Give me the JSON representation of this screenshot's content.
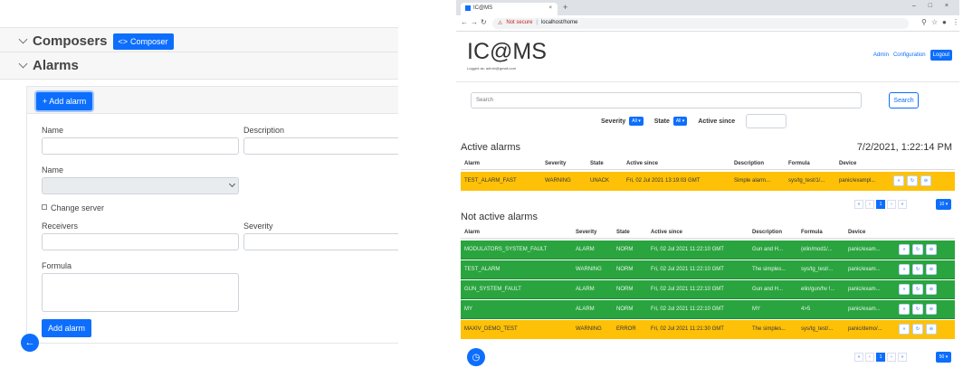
{
  "left": {
    "composers_title": "Composers",
    "composer_button": "Composer",
    "composer_icon": "code-icon",
    "alarms_title": "Alarms",
    "add_alarm_top": "+ Add alarm",
    "name_label": "Name",
    "description_label": "Description",
    "name2_label": "Name",
    "change_server_label": "Change server",
    "receivers_label": "Receivers",
    "severity_label": "Severity",
    "formula_label": "Formula",
    "add_alarm_button": "Add alarm",
    "back_icon": "←"
  },
  "browser": {
    "tab_title": "IC@MS",
    "tab_close": "×",
    "new_tab": "+",
    "window_controls": "– □ ×",
    "not_secure": "Not secure",
    "url": "localhost/home"
  },
  "app": {
    "brand": "IC@MS",
    "logged_as": "Logged as: admin@gmail.com",
    "nav": {
      "admin": "Admin",
      "configuration": "Configuration",
      "logout": "Logout"
    },
    "search_placeholder": "Search",
    "search_button": "Search",
    "filters": {
      "severity": "Severity",
      "state": "State",
      "all": "All ▾",
      "active_since": "Active since"
    },
    "active_title": "Active alarms",
    "datetime": "7/2/2021, 1:22:14 PM",
    "not_active_title": "Not active alarms",
    "columns": {
      "alarm": "Alarm",
      "severity": "Severity",
      "state": "State",
      "active_since": "Active since",
      "description": "Description",
      "formula": "Formula",
      "device": "Device"
    },
    "active_rows": [
      {
        "alarm": "TEST_ALARM_FAST",
        "severity": "WARNING",
        "state": "UNACK",
        "since": "Fri, 02 Jul 2021 13:19:03 GMT",
        "description": "Simple alarm...",
        "formula": "sys/tg_test/1/...",
        "device": "panic/exampl..."
      }
    ],
    "not_active_rows": [
      {
        "alarm": "MODULATORS_SYSTEM_FAULT",
        "severity": "ALARM",
        "state": "NORM",
        "since": "Fri, 02 Jul 2021 11:22:10 GMT",
        "description": "Gun and H...",
        "formula": "(elin/mod1/...",
        "device": "panic/exam..."
      },
      {
        "alarm": "TEST_ALARM",
        "severity": "WARNING",
        "state": "NORM",
        "since": "Fri, 02 Jul 2021 11:22:10 GMT",
        "description": "The simples...",
        "formula": "sys/tg_test/...",
        "device": "panic/exam..."
      },
      {
        "alarm": "GUN_SYSTEM_FAULT",
        "severity": "ALARM",
        "state": "NORM",
        "since": "Fri, 02 Jul 2021 11:22:10 GMT",
        "description": "Gun and H...",
        "formula": "elin/gun/hv !...",
        "device": "panic/exam..."
      },
      {
        "alarm": "MY",
        "severity": "ALARM",
        "state": "NORM",
        "since": "Fri, 02 Jul 2021 11:22:10 GMT",
        "description": "MY",
        "formula": "4>5",
        "device": "panic/exam..."
      },
      {
        "alarm": "MAXIV_DEMO_TEST",
        "severity": "WARNING",
        "state": "ERROR",
        "since": "Fri, 02 Jul 2021 11:21:30 GMT",
        "description": "The simples...",
        "formula": "sys/tg_test/...",
        "device": "panic/demo/..."
      }
    ],
    "pager": {
      "first": "«",
      "prev": "‹",
      "page": "1",
      "next": "›",
      "last": "»"
    },
    "per_page_active": "10 ▾",
    "per_page_not_active": "50 ▾",
    "row_actions": [
      "«",
      "↻",
      "⊖"
    ]
  },
  "colors": {
    "primary": "#0d6efd",
    "warning_row": "#ffc107",
    "alarm_row": "#2aa43f"
  }
}
